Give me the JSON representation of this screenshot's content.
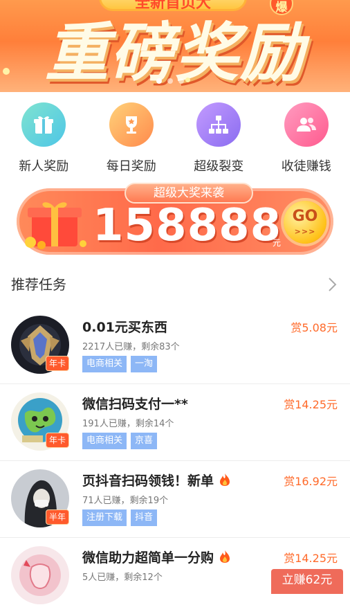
{
  "banner": {
    "pill_text": "全新首页大",
    "hot_badge": "爆",
    "headline": "重磅奖励",
    "dots": 3
  },
  "entries": [
    {
      "label": "新人奖励",
      "icon": "gift-icon"
    },
    {
      "label": "每日奖励",
      "icon": "trophy-icon"
    },
    {
      "label": "超级裂变",
      "icon": "network-icon"
    },
    {
      "label": "收徒赚钱",
      "icon": "people-icon"
    }
  ],
  "jackpot": {
    "tag": "超级大奖来袭",
    "amount": "158888",
    "unit": "元",
    "go_label": "GO",
    "go_arrows": ">>>"
  },
  "section": {
    "title": "推荐任务"
  },
  "tasks": [
    {
      "title": "0.01元买东西",
      "meta": "2217人已赚，剩余83个",
      "tags": [
        "电商相关",
        "一淘"
      ],
      "reward": "赏5.08元",
      "badge": "年卡",
      "fire": false
    },
    {
      "title": "微信扫码支付一**",
      "meta": "191人已赚，剩余14个",
      "tags": [
        "电商相关",
        "京喜"
      ],
      "reward": "赏14.25元",
      "badge": "年卡",
      "fire": false
    },
    {
      "title": "页抖音扫码领钱！新单",
      "meta": "71人已赚，剩余19个",
      "tags": [
        "注册下载",
        "抖音"
      ],
      "reward": "赏16.92元",
      "badge": "半年",
      "fire": true
    },
    {
      "title": "微信助力超简单一分购",
      "meta": "5人已赚，剩余12个",
      "tags": [],
      "reward": "赏14.25元",
      "badge": "",
      "fire": true
    }
  ],
  "float_button": "立赚62元",
  "colors": {
    "accent": "#ff6a2a",
    "tag_blue": "#8db7f6",
    "banner_orange": "#ff7f3a"
  }
}
